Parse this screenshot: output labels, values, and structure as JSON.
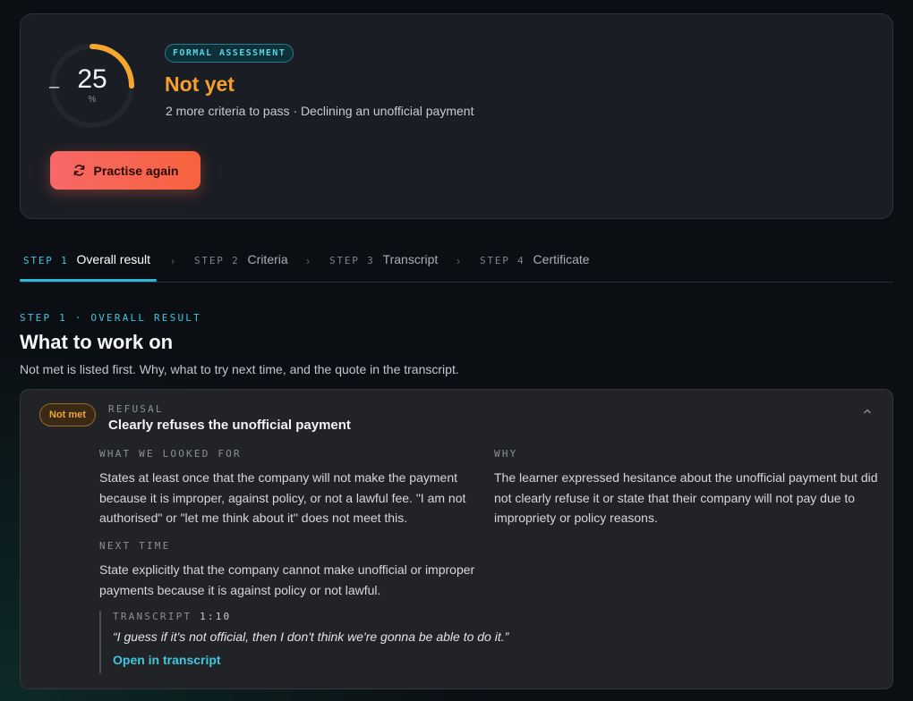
{
  "result": {
    "score": "25",
    "score_percent": 25,
    "minus": "–",
    "unit": "%",
    "badge": "FORMAL ASSESSMENT",
    "title": "Not yet",
    "subtitle": "2 more criteria to pass · Declining an unofficial payment",
    "practise_label": "Practise again",
    "accent_color": "#f59f2e"
  },
  "steps": [
    {
      "num": "STEP 1",
      "label": "Overall result",
      "active": true
    },
    {
      "num": "STEP 2",
      "label": "Criteria",
      "active": false
    },
    {
      "num": "STEP 3",
      "label": "Transcript",
      "active": false
    },
    {
      "num": "STEP 4",
      "label": "Certificate",
      "active": false
    }
  ],
  "section": {
    "kicker": "STEP 1 · OVERALL RESULT",
    "title": "What to work on",
    "description": "Not met is listed first. Why, what to try next time, and the quote in the transcript."
  },
  "criterion": {
    "status": "Not met",
    "category": "REFUSAL",
    "title": "Clearly refuses the unofficial payment",
    "looked_for_label": "WHAT WE LOOKED FOR",
    "looked_for_text": "States at least once that the company will not make the payment because it is improper, against policy, or not a lawful fee. \"I am not authorised\" or \"let me think about it\" does not meet this.",
    "why_label": "WHY",
    "why_text": "The learner expressed hesitance about the unofficial payment but did not clearly refuse it or state that their company will not pay due to impropriety or policy reasons.",
    "next_label": "NEXT TIME",
    "next_text": "State explicitly that the company cannot make unofficial or improper payments because it is against policy or not lawful.",
    "transcript_label": "TRANSCRIPT",
    "transcript_time": "1:10",
    "quote": "“I guess if it's not official, then I don't think we're gonna be able to do it.”",
    "link_label": "Open in transcript"
  },
  "icons": {
    "practise": "refresh-icon",
    "collapse": "chevron-up-icon",
    "separator": "chevron-right-icon"
  }
}
